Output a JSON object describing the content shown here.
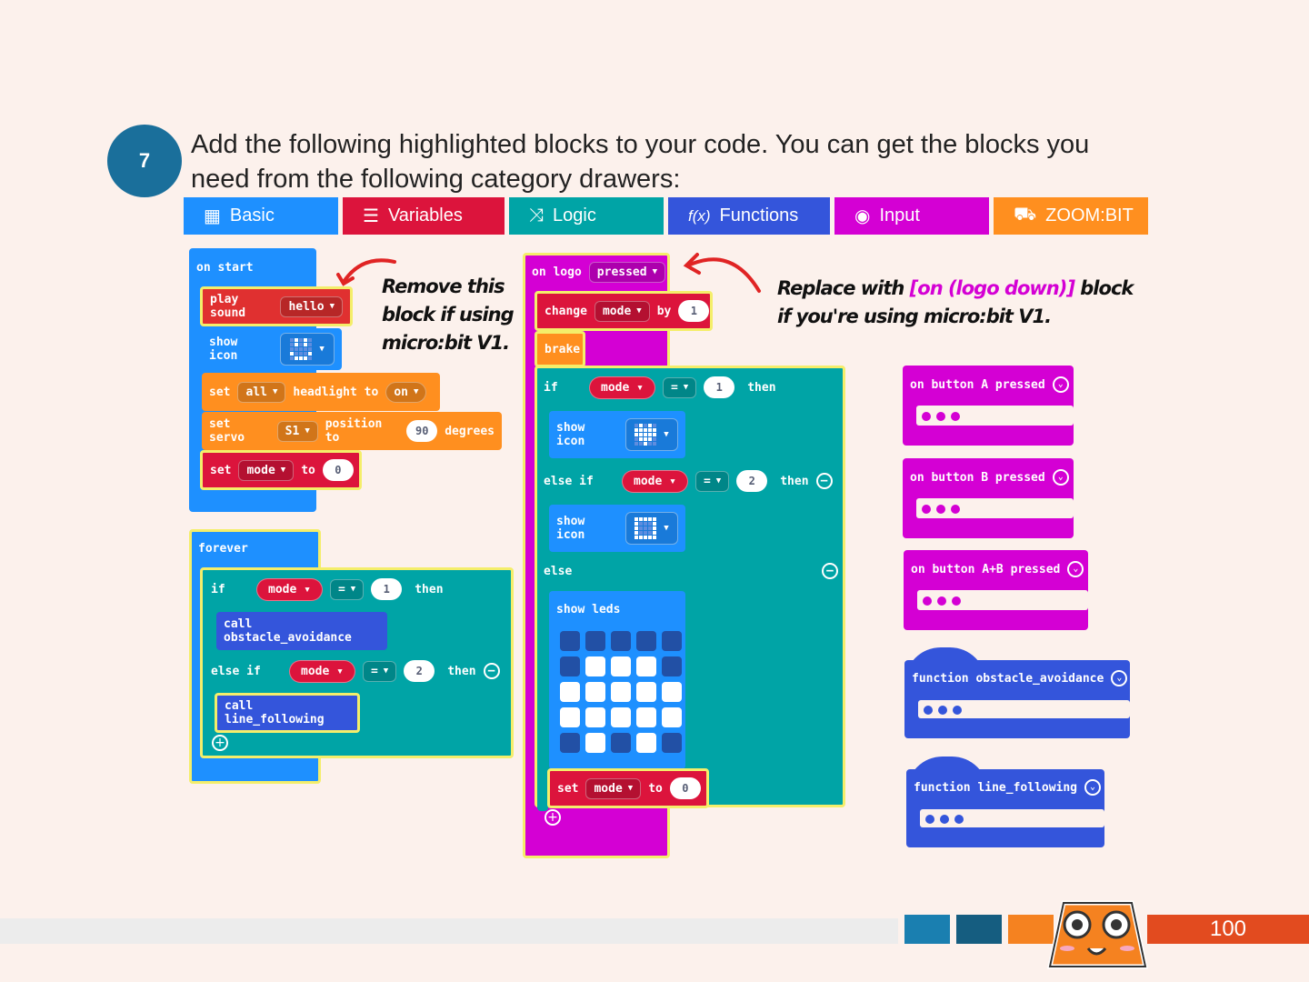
{
  "step_number": "7",
  "instruction_line1": "Add the following highlighted blocks to your code. You can get the blocks you",
  "instruction_line2": "need from the following category drawers:",
  "categories": [
    {
      "label": "Basic",
      "icon": "grid-icon",
      "color": "#1e90ff"
    },
    {
      "label": "Variables",
      "icon": "list-icon",
      "color": "#dc143c"
    },
    {
      "label": "Logic",
      "icon": "shuffle-icon",
      "color": "#00a4a6"
    },
    {
      "label": "Functions",
      "icon": "function-icon",
      "color": "#3455db"
    },
    {
      "label": "Input",
      "icon": "radio-icon",
      "color": "#d400d4"
    },
    {
      "label": "ZOOM:BIT",
      "icon": "car-icon",
      "color": "#ff8f1f"
    }
  ],
  "note_left": [
    "Remove this",
    "block if using",
    "micro:bit V1."
  ],
  "note_right": {
    "before": "Replace with ",
    "highlight": "[on (logo down)]",
    "after": " block",
    "line2": "if you're using micro:bit V1."
  },
  "on_start": {
    "title": "on start",
    "play_sound": "play sound",
    "sound": "hello",
    "show_icon": "show icon",
    "set": "set",
    "all": "all",
    "headlight_to": "headlight to",
    "on": "on",
    "set_servo": "set servo",
    "servo": "S1",
    "position_to": "position to",
    "degrees_value": "90",
    "degrees": "degrees",
    "var": "mode",
    "to": "to",
    "init_value": "0"
  },
  "forever": {
    "title": "forever",
    "if": "if",
    "var": "mode",
    "op": "=",
    "val1": "1",
    "then": "then",
    "call1": "call obstacle_avoidance",
    "else_if": "else if",
    "val2": "2",
    "call2": "call line_following"
  },
  "on_logo": {
    "on_logo": "on logo",
    "pressed": "pressed",
    "change": "change",
    "var": "mode",
    "by": "by",
    "by_value": "1",
    "brake": "brake",
    "if": "if",
    "op": "=",
    "val1": "1",
    "then": "then",
    "show_icon": "show icon",
    "else_if": "else if",
    "val2": "2",
    "else": "else",
    "show_leds": "show leds",
    "leds": [
      0,
      0,
      0,
      0,
      0,
      0,
      1,
      1,
      1,
      0,
      1,
      1,
      1,
      1,
      1,
      1,
      1,
      1,
      1,
      1,
      0,
      1,
      0,
      1,
      0
    ],
    "set": "set",
    "to": "to",
    "set_value": "0"
  },
  "events": [
    {
      "label": "on button A pressed"
    },
    {
      "label": "on button B pressed"
    },
    {
      "label": "on button A+B pressed"
    }
  ],
  "functions": [
    {
      "label": "function obstacle_avoidance"
    },
    {
      "label": "function line_following"
    }
  ],
  "page_number": "100"
}
